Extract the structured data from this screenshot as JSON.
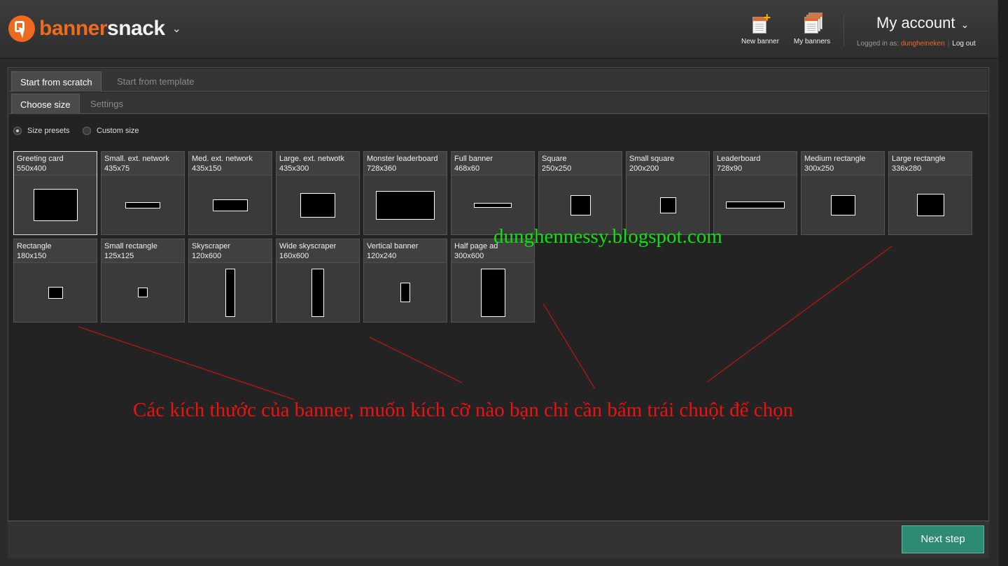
{
  "header": {
    "logo_part1": "banner",
    "logo_part2": "snack",
    "logo_chevron": "⌄",
    "new_banner_label": "New banner",
    "my_banners_label": "My banners",
    "account_label": "My account",
    "account_chevron": "⌄",
    "logged_prefix": "Logged in as:",
    "username": "dungheineken",
    "separator": "|",
    "logout_label": "Log out"
  },
  "tabs": {
    "primary": [
      "Start from scratch",
      "Start from template"
    ],
    "secondary": [
      "Choose size",
      "Settings"
    ]
  },
  "size_mode": {
    "presets_label": "Size presets",
    "custom_label": "Custom size",
    "selected": "presets"
  },
  "presets": [
    {
      "name": "Greeting card",
      "size": "550x400",
      "w": 550,
      "h": 400,
      "selected": true
    },
    {
      "name": "Small. ext. network",
      "size": "435x75",
      "w": 435,
      "h": 75
    },
    {
      "name": "Med. ext. network",
      "size": "435x150",
      "w": 435,
      "h": 150
    },
    {
      "name": "Large. ext. netwotk",
      "size": "435x300",
      "w": 435,
      "h": 300
    },
    {
      "name": "Monster leaderboard",
      "size": "728x360",
      "w": 728,
      "h": 360
    },
    {
      "name": "Full banner",
      "size": "468x60",
      "w": 468,
      "h": 60
    },
    {
      "name": "Square",
      "size": "250x250",
      "w": 250,
      "h": 250
    },
    {
      "name": "Small square",
      "size": "200x200",
      "w": 200,
      "h": 200
    },
    {
      "name": "Leaderboard",
      "size": "728x90",
      "w": 728,
      "h": 90
    },
    {
      "name": "Medium rectangle",
      "size": "300x250",
      "w": 300,
      "h": 250
    },
    {
      "name": "Large rectangle",
      "size": "336x280",
      "w": 336,
      "h": 280
    },
    {
      "name": "Rectangle",
      "size": "180x150",
      "w": 180,
      "h": 150
    },
    {
      "name": "Small rectangle",
      "size": "125x125",
      "w": 125,
      "h": 125
    },
    {
      "name": "Skyscraper",
      "size": "120x600",
      "w": 120,
      "h": 600
    },
    {
      "name": "Wide skyscraper",
      "size": "160x600",
      "w": 160,
      "h": 600
    },
    {
      "name": "Vertical banner",
      "size": "120x240",
      "w": 120,
      "h": 240
    },
    {
      "name": "Half page ad",
      "size": "300x600",
      "w": 300,
      "h": 600
    }
  ],
  "next_button": "Next step",
  "watermark": "dunghennessy.blogspot.com",
  "annotation": "Các kích thước của banner, muốn kích cỡ nào bạn chỉ cần bấm trái chuột để chọn",
  "colors": {
    "brand": "#ee6a1f",
    "next_button": "#2d8a74",
    "watermark": "#10e010",
    "annotation": "#ee1111"
  }
}
